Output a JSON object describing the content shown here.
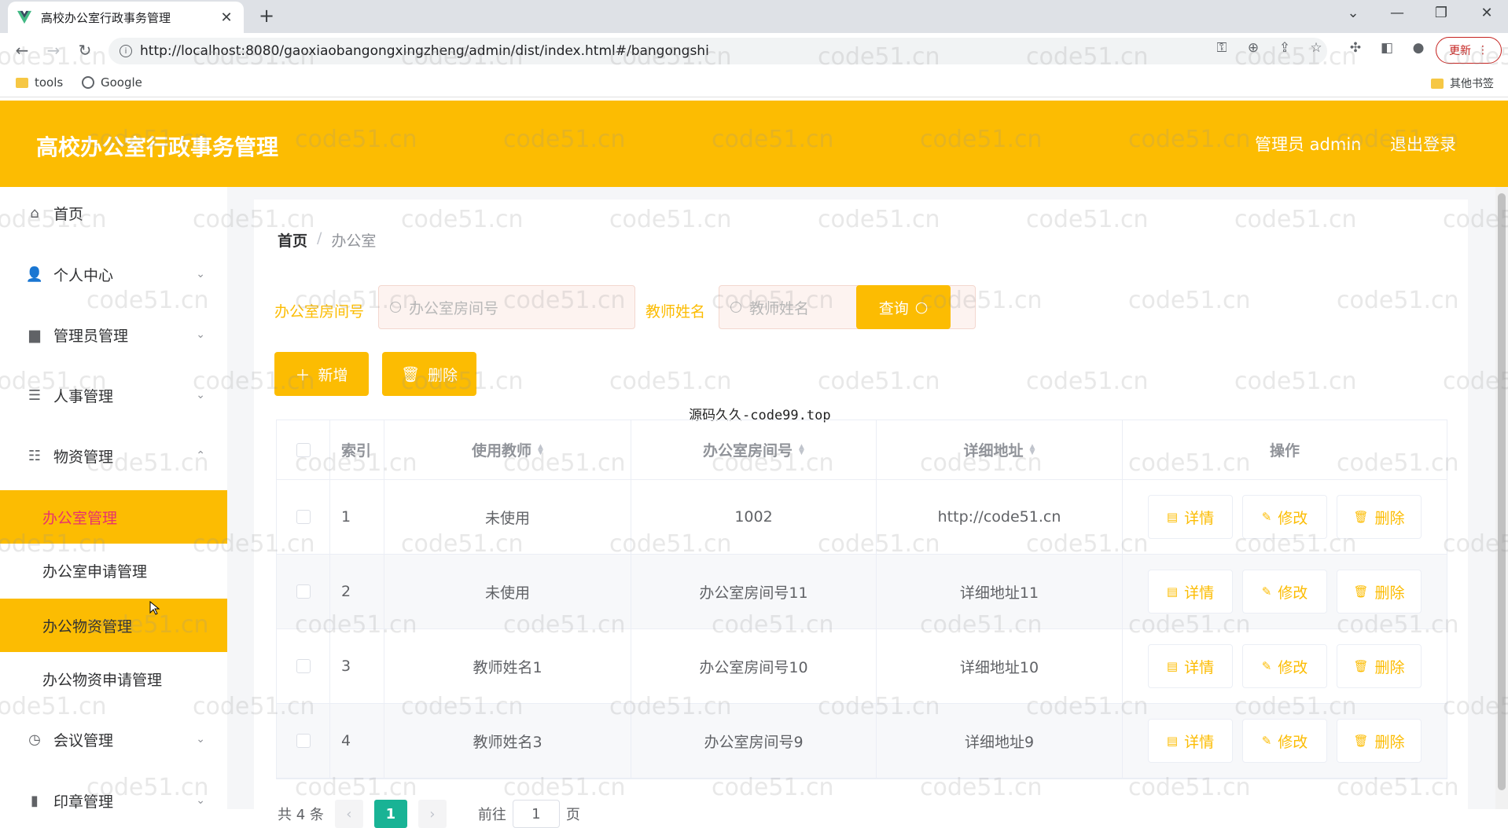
{
  "browser": {
    "tab_title": "高校办公室行政事务管理",
    "url": "http://localhost:8080/gaoxiaobangongxingzheng/admin/dist/index.html#/bangongshi",
    "update_label": "更新",
    "bookmarks": [
      "tools",
      "Google"
    ],
    "other_bookmarks": "其他书签"
  },
  "header": {
    "title": "高校办公室行政事务管理",
    "user": "管理员 admin",
    "logout": "退出登录"
  },
  "sidebar": {
    "items": [
      {
        "label": "首页",
        "icon": "home-icon"
      },
      {
        "label": "个人中心",
        "icon": "user-icon"
      },
      {
        "label": "管理员管理",
        "icon": "briefcase-icon"
      },
      {
        "label": "人事管理",
        "icon": "list-icon"
      },
      {
        "label": "物资管理",
        "icon": "sliders-icon"
      },
      {
        "label": "会议管理",
        "icon": "compass-icon"
      },
      {
        "label": "印章管理",
        "icon": "bar-chart-icon"
      }
    ],
    "sub_items": [
      {
        "label": "办公室管理"
      },
      {
        "label": "办公室申请管理"
      },
      {
        "label": "办公物资管理"
      },
      {
        "label": "办公物资申请管理"
      }
    ]
  },
  "breadcrumb": {
    "home": "首页",
    "separator": "/",
    "current": "办公室"
  },
  "search": {
    "room_label": "办公室房间号",
    "room_placeholder": "办公室房间号",
    "teacher_label": "教师姓名",
    "teacher_placeholder": "教师姓名",
    "query_label": "查询"
  },
  "actions": {
    "add_label": "新增",
    "delete_label": "删除"
  },
  "float_note": "源码久久-code99.top",
  "table": {
    "headers": [
      "索引",
      "使用教师",
      "办公室房间号",
      "详细地址",
      "操作"
    ],
    "rows": [
      {
        "index": "1",
        "teacher": "未使用",
        "room": "1002",
        "address": "http://code51.cn"
      },
      {
        "index": "2",
        "teacher": "未使用",
        "room": "办公室房间号11",
        "address": "详细地址11"
      },
      {
        "index": "3",
        "teacher": "教师姓名1",
        "room": "办公室房间号10",
        "address": "详细地址10"
      },
      {
        "index": "4",
        "teacher": "教师姓名3",
        "room": "办公室房间号9",
        "address": "详细地址9"
      }
    ],
    "op_labels": {
      "detail": "详情",
      "edit": "修改",
      "delete": "删除"
    }
  },
  "pager": {
    "total": "共 4 条",
    "current_page": "1",
    "goto_prefix": "前往",
    "goto_value": "1",
    "goto_suffix": "页"
  },
  "watermark": "code51.cn",
  "colors": {
    "accent": "#fcbc02",
    "active_text": "#e8336d",
    "pager_active": "#19b395"
  }
}
